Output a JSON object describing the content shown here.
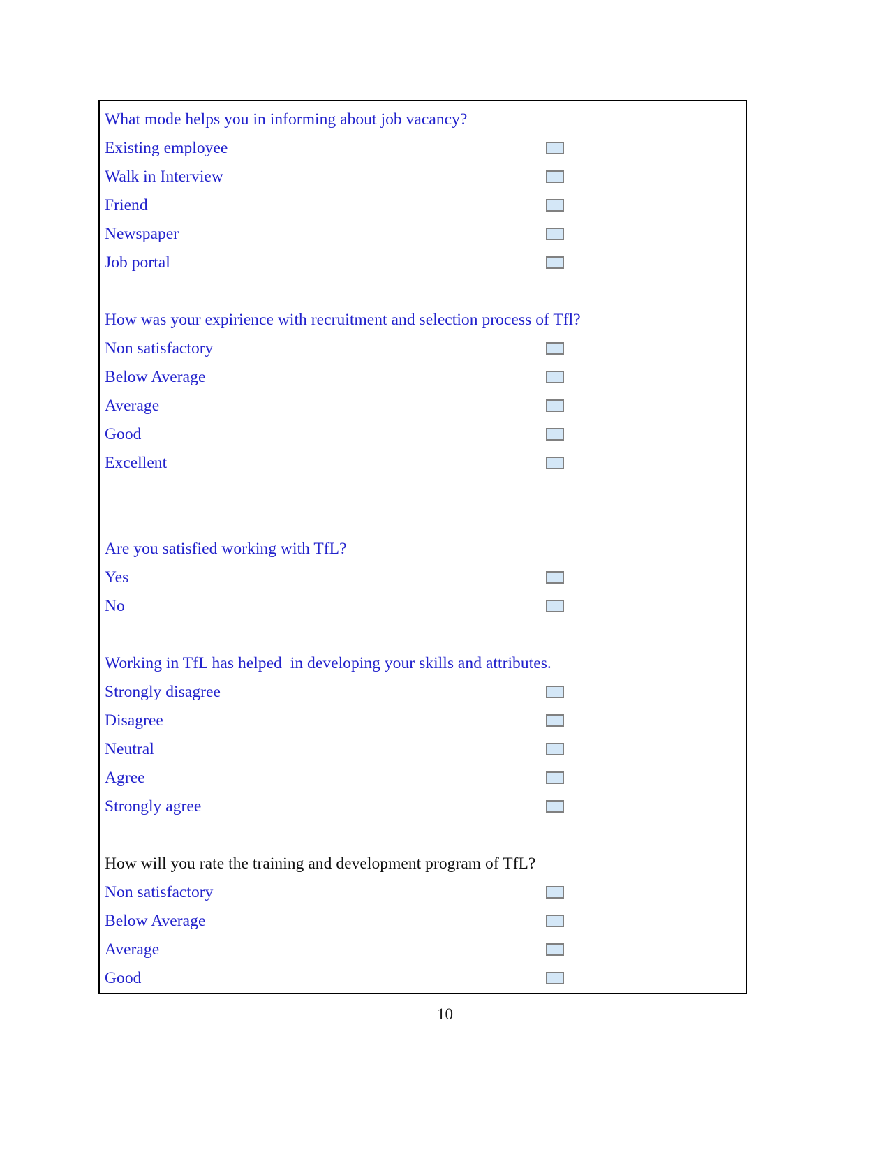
{
  "document": {
    "page_number": "10",
    "text_color": "#2222cc",
    "alt_text_color": "#111111",
    "checkbox_fill": "#d4e7f7",
    "checkbox_border": "#808080",
    "frame_border": "#000000"
  },
  "questions": [
    {
      "id": "job-vacancy-mode",
      "title": "What mode helps you in informing about job vacancy?",
      "title_color": "blue",
      "options": [
        {
          "label": "Existing employee",
          "checked": false
        },
        {
          "label": "Walk in Interview",
          "checked": false
        },
        {
          "label": "Friend",
          "checked": false
        },
        {
          "label": "Newspaper",
          "checked": false
        },
        {
          "label": "Job portal",
          "checked": false
        }
      ]
    },
    {
      "id": "recruitment-experience",
      "title": "How was your expirience with recruitment and selection process of Tfl?",
      "title_color": "blue",
      "options": [
        {
          "label": "Non satisfactory",
          "checked": false
        },
        {
          "label": "Below Average",
          "checked": false
        },
        {
          "label": "Average",
          "checked": false
        },
        {
          "label": "Good",
          "checked": false
        },
        {
          "label": "Excellent",
          "checked": false
        }
      ]
    },
    {
      "id": "satisfaction",
      "title": "Are you satisfied working with TfL?",
      "title_color": "blue",
      "options": [
        {
          "label": "Yes",
          "checked": false
        },
        {
          "label": "No",
          "checked": false
        }
      ]
    },
    {
      "id": "skills-development",
      "title": "Working in TfL has helped  in developing your skills and attributes.",
      "title_color": "blue",
      "options": [
        {
          "label": "Strongly disagree",
          "checked": false
        },
        {
          "label": "Disagree",
          "checked": false
        },
        {
          "label": "Neutral",
          "checked": false
        },
        {
          "label": "Agree",
          "checked": false
        },
        {
          "label": "Strongly agree",
          "checked": false
        }
      ]
    },
    {
      "id": "training-program-rating",
      "title": "How will you rate the training and development program of TfL?",
      "title_color": "black",
      "options": [
        {
          "label": "Non satisfactory",
          "checked": false
        },
        {
          "label": "Below Average",
          "checked": false
        },
        {
          "label": "Average",
          "checked": false
        },
        {
          "label": "Good",
          "checked": false
        }
      ]
    }
  ]
}
